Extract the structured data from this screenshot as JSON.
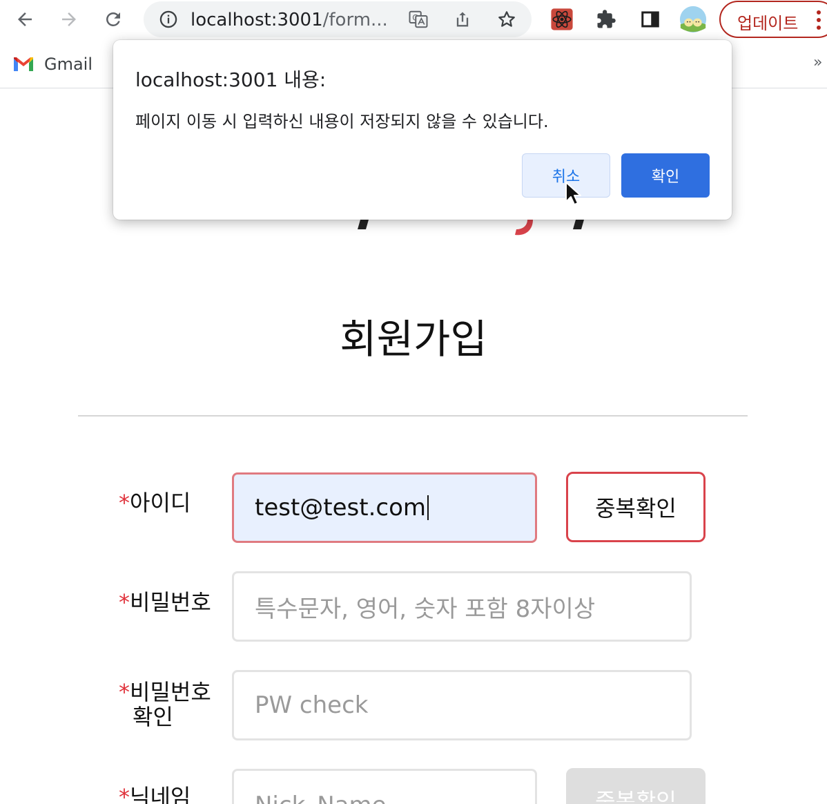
{
  "browser": {
    "url_host": "localhost:3001",
    "url_path": "/form...",
    "update_label": "업데이트",
    "bookmarks": {
      "gmail_label": "Gmail",
      "more": "»"
    }
  },
  "dialog": {
    "title": "localhost:3001 내용:",
    "message": "페이지 이동 시 입력하신 내용이 저장되지 않을 수 있습니다.",
    "cancel_label": "취소",
    "ok_label": "확인"
  },
  "page": {
    "title": "회원가입",
    "form": {
      "required_mark": "*",
      "id_label": "아이디",
      "id_value": "test@test.com",
      "id_check_label": "중복확인",
      "pw_label": "비밀번호",
      "pw_placeholder": "특수문자, 영어, 숫자 포함 8자이상",
      "pw_confirm_label_1": "비밀번호",
      "pw_confirm_label_2": "확인",
      "pw_confirm_placeholder": "PW check",
      "nick_label": "닉네임",
      "nick_placeholder": "Nick_Name",
      "nick_check_label": "중복확인"
    }
  },
  "colors": {
    "accent_red": "#d9434b",
    "dialog_blue": "#2f6fe0"
  }
}
